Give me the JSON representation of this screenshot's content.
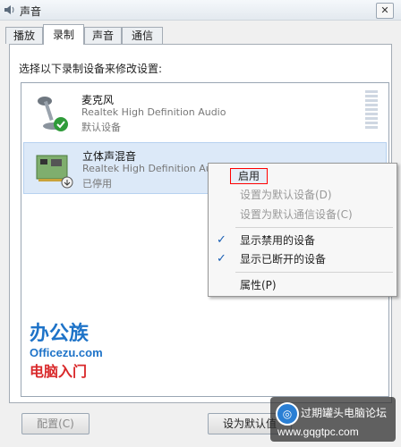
{
  "window": {
    "title": "声音",
    "close_label": "✕"
  },
  "tabs": [
    {
      "label": "播放"
    },
    {
      "label": "录制"
    },
    {
      "label": "声音"
    },
    {
      "label": "通信"
    }
  ],
  "active_tab": "录制",
  "instruction": "选择以下录制设备来修改设置:",
  "devices": [
    {
      "name": "麦克风",
      "driver": "Realtek High Definition Audio",
      "status": "默认设备"
    },
    {
      "name": "立体声混音",
      "driver": "Realtek High Definition Audio",
      "status": "已停用"
    }
  ],
  "context_menu": {
    "items": [
      {
        "label": "启用",
        "state": "highlighted"
      },
      {
        "label": "设置为默认设备(D)",
        "state": "disabled"
      },
      {
        "label": "设置为默认通信设备(C)",
        "state": "disabled"
      },
      {
        "label": "显示禁用的设备",
        "checked": true
      },
      {
        "label": "显示已断开的设备",
        "checked": true
      },
      {
        "label": "属性(P)"
      }
    ],
    "check_glyph": "✓"
  },
  "buttons": {
    "configure": "配置(C)",
    "set_default": "设为默认值"
  },
  "logo": {
    "cn": "办公族",
    "url": "Officezu.com",
    "sub": "电脑入门"
  },
  "watermark": {
    "name": "过期罐头电脑论坛",
    "url": "www.gqgtpc.com"
  },
  "colors": {
    "accent": "#1a5fb4",
    "highlight_border": "#ff0000",
    "selection": "#dce9f8"
  }
}
